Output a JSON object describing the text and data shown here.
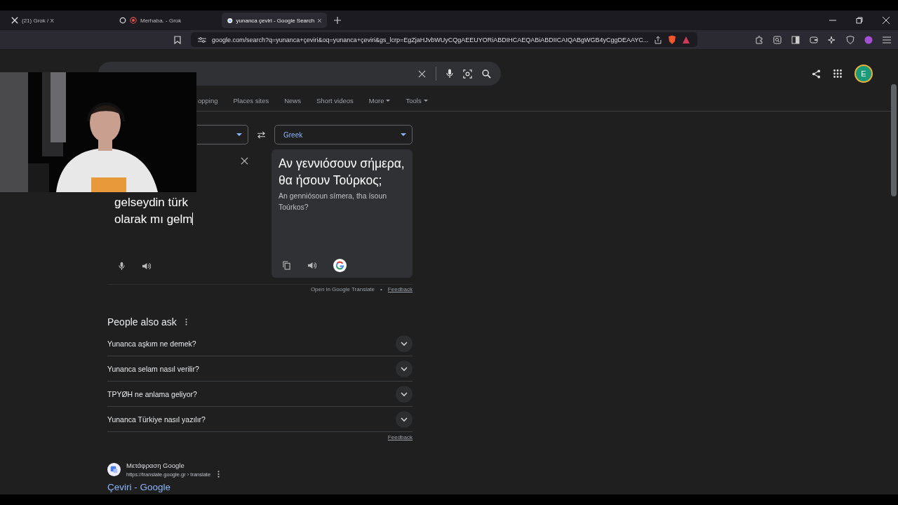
{
  "browser": {
    "tabs": [
      {
        "title": "(21) Grok / X",
        "kind": "x",
        "selected": false
      },
      {
        "title": "Merhaba. - Grok",
        "kind": "grok",
        "selected": false
      },
      {
        "title": "yunanca çeviri - Google Search",
        "kind": "google",
        "selected": true
      }
    ],
    "url": "google.com/search?q=yunanca+çeviri&oq=yunanca+çeviri&gs_lcrp=EgZjaHJvbWUyCQgAEEUYORiABDIHCAEQABiABDIICAIQABgWGB4yCggDEAAYC..."
  },
  "header": {
    "avatar": "E"
  },
  "filters": [
    "opping",
    "Places sites",
    "News",
    "Short videos",
    "More",
    "Tools"
  ],
  "translate": {
    "source_text": "gelseydin türk olarak mı gelm",
    "target_language": "Greek",
    "translation": "Αν γεννιόσουν σήμερα, θα ήσουν Τούρκος;",
    "transliteration": "An genniósoun símera, tha ísoun Toúrkos?",
    "open_link": "Open in Google Translate",
    "separator": "•",
    "feedback": "Feedback"
  },
  "people_also_ask": {
    "title": "People also ask",
    "questions": [
      {
        "text": "Yunanca aşkım ne demek?",
        "expanded": false
      },
      {
        "text": "Yunanca selam nasıl verilir?",
        "expanded": false
      },
      {
        "text": "TPYØH ne anlama geliyor?",
        "expanded": false
      },
      {
        "text": "Yunanca Türkiye nasıl yazılır?",
        "expanded": false
      }
    ],
    "feedback": "Feedback"
  },
  "result": {
    "site_name": "Μετάφραση Google",
    "url": "https://translate.google.gr › translate",
    "title": "Çeviri - Google"
  }
}
